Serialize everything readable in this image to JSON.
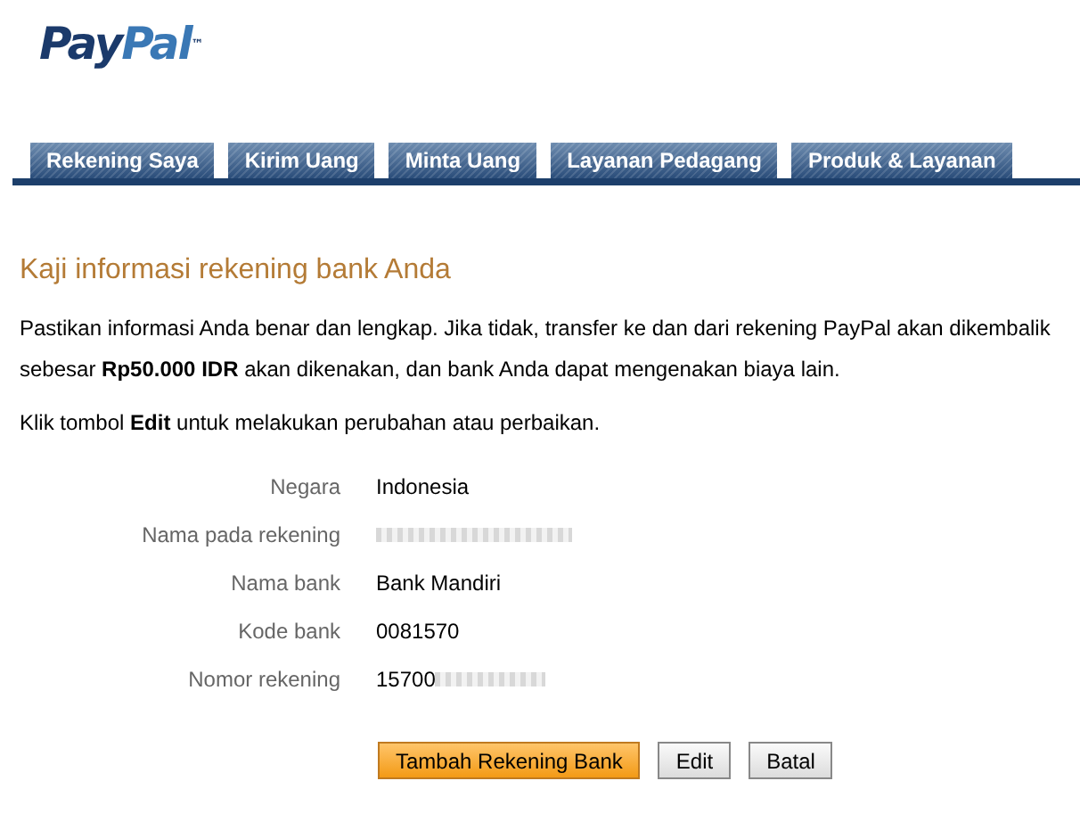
{
  "logo": {
    "text_dark": "Pay",
    "text_light": "Pal",
    "mark": "™"
  },
  "tabs": [
    {
      "label": "Rekening Saya",
      "selected": false
    },
    {
      "label": "Kirim Uang",
      "selected": false
    },
    {
      "label": "Minta Uang",
      "selected": false
    },
    {
      "label": "Layanan Pedagang",
      "selected": false
    },
    {
      "label": "Produk & Layanan",
      "selected": false
    }
  ],
  "heading": "Kaji informasi rekening bank Anda",
  "intro": {
    "lines": [
      "Pastikan informasi Anda benar dan lengkap. Jika tidak, transfer ke dan dari rekening PayPal akan dikembalik",
      "sebesar **Rp50.000 IDR** akan dikenakan, dan bank Anda dapat mengenakan biaya lain."
    ]
  },
  "hint": "Klik tombol **Edit** untuk melakukan perubahan atau perbaikan.",
  "fields": [
    {
      "label": "Negara",
      "value": "Indonesia",
      "redacted": false
    },
    {
      "label": "Nama pada rekening",
      "redacted": true
    },
    {
      "label": "Nama bank",
      "value": "Bank Mandiri",
      "redacted": false
    },
    {
      "label": "Kode bank",
      "value": "0081570",
      "redacted": false
    },
    {
      "label": "Nomor rekening",
      "value": "15700",
      "redacted": true
    }
  ],
  "buttons": [
    {
      "label": "Tambah Rekening Bank",
      "kind": "primary"
    },
    {
      "label": "Edit",
      "kind": "secondary"
    },
    {
      "label": "Batal",
      "kind": "secondary"
    }
  ]
}
